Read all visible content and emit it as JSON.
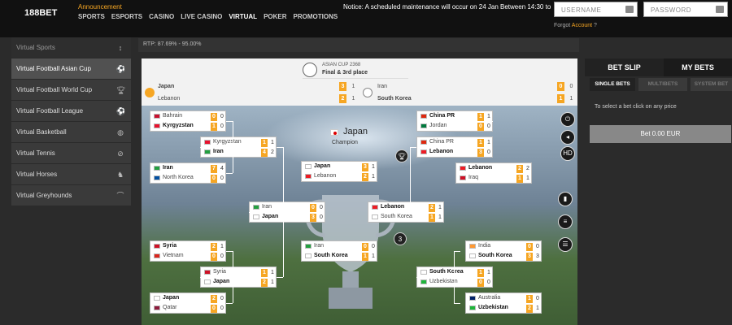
{
  "brand": {
    "logo": "188BET"
  },
  "header": {
    "announcement": "Announcement",
    "nav": [
      "SPORTS",
      "ESPORTS",
      "CASINO",
      "LIVE CASINO",
      "VIRTUAL",
      "POKER",
      "PROMOTIONS"
    ],
    "active_nav": "VIRTUAL",
    "notice": "Notice: A scheduled maintenance will occur on 24 Jan Between 14:30 to",
    "username_placeholder": "USERNAME",
    "password_placeholder": "PASSWORD",
    "forgot": "Forgot",
    "account": "Account",
    "forgot_suffix": "?"
  },
  "sidebar": {
    "items": [
      {
        "label": "Virtual Sports",
        "icon": "az-sort-icon"
      },
      {
        "label": "Virtual Football Asian Cup",
        "icon": "soccer-ball-icon"
      },
      {
        "label": "Virtual Football World Cup",
        "icon": "trophy-icon"
      },
      {
        "label": "Virtual Football League",
        "icon": "soccer-ball-icon"
      },
      {
        "label": "Virtual Basketball",
        "icon": "basketball-icon"
      },
      {
        "label": "Virtual Tennis",
        "icon": "tennis-icon"
      },
      {
        "label": "Virtual Horses",
        "icon": "horse-icon"
      },
      {
        "label": "Virtual Greyhounds",
        "icon": "greyhound-icon"
      }
    ]
  },
  "rtp": "RTP: 87.69% - 95.00%",
  "event": {
    "small": "ASIAN CUP 2368",
    "title": "Final & 3rd place"
  },
  "finals": {
    "left": [
      {
        "team": "Japan",
        "s1": "3",
        "s2": "1"
      },
      {
        "team": "Lebanon",
        "s1": "2",
        "s2": "1"
      }
    ],
    "right": [
      {
        "team": "Iran",
        "s1": "0",
        "s2": "0"
      },
      {
        "team": "South Korea",
        "s1": "1",
        "s2": "1"
      }
    ]
  },
  "champion": {
    "team": "Japan",
    "label": "Champion"
  },
  "third_place_badge": "3",
  "bracket": [
    {
      "t1": "Bahrain",
      "s1a": "0",
      "s1b": "0",
      "t2": "Kyrgyzstan",
      "s2a": "1",
      "s2b": "0"
    },
    {
      "t1": "Kyrgyzstan",
      "s1a": "1",
      "s1b": "1",
      "t2": "Iran",
      "s2a": "4",
      "s2b": "2"
    },
    {
      "t1": "Iran",
      "s1a": "7",
      "s1b": "4",
      "t2": "North Korea",
      "s2a": "0",
      "s2b": "0"
    },
    {
      "t1": "Japan",
      "s1a": "3",
      "s1b": "1",
      "t2": "Lebanon",
      "s2a": "2",
      "s2b": "1"
    },
    {
      "t1": "Iran",
      "s1a": "0",
      "s1b": "0",
      "t2": "Japan",
      "s2a": "3",
      "s2b": "0"
    },
    {
      "t1": "Lebanon",
      "s1a": "2",
      "s1b": "1",
      "t2": "South Korea",
      "s2a": "1",
      "s2b": "1"
    },
    {
      "t1": "Syria",
      "s1a": "2",
      "s1b": "1",
      "t2": "Vietnam",
      "s2a": "0",
      "s2b": "0"
    },
    {
      "t1": "Syria",
      "s1a": "1",
      "s1b": "1",
      "t2": "Japan",
      "s2a": "2",
      "s2b": "1"
    },
    {
      "t1": "Japan",
      "s1a": "2",
      "s1b": "0",
      "t2": "Qatar",
      "s2a": "0",
      "s2b": "0"
    },
    {
      "t1": "Iran",
      "s1a": "0",
      "s1b": "0",
      "t2": "South Korea",
      "s2a": "1",
      "s2b": "1"
    },
    {
      "t1": "China PR",
      "s1a": "1",
      "s1b": "1",
      "t2": "Jordan",
      "s2a": "0",
      "s2b": "0"
    },
    {
      "t1": "China PR",
      "s1a": "1",
      "s1b": "1",
      "t2": "Lebanon",
      "s2a": "3",
      "s2b": "0"
    },
    {
      "t1": "Lebanon",
      "s1a": "2",
      "s1b": "2",
      "t2": "Iraq",
      "s2a": "1",
      "s2b": "1"
    },
    {
      "t1": "India",
      "s1a": "0",
      "s1b": "0",
      "t2": "South Korea",
      "s2a": "3",
      "s2b": "3"
    },
    {
      "t1": "South Korea",
      "s1a": "1",
      "s1b": "1",
      "t2": "Uzbekistan",
      "s2a": "0",
      "s2b": "0"
    },
    {
      "t1": "Australia",
      "s1a": "1",
      "s1b": "0",
      "t2": "Uzbekistan",
      "s2a": "2",
      "s2b": "1"
    }
  ],
  "betslip": {
    "tab_active": "BET SLIP",
    "tab_other": "MY BETS",
    "subtabs": [
      "SINGLE BETS",
      "MULTIBETS",
      "SYSTEM BET"
    ],
    "message": "To select a bet click on any price",
    "button": "Bet 0.00 EUR"
  },
  "colors": {
    "accent": "#f6a623",
    "bg": "#2b2b2b"
  }
}
